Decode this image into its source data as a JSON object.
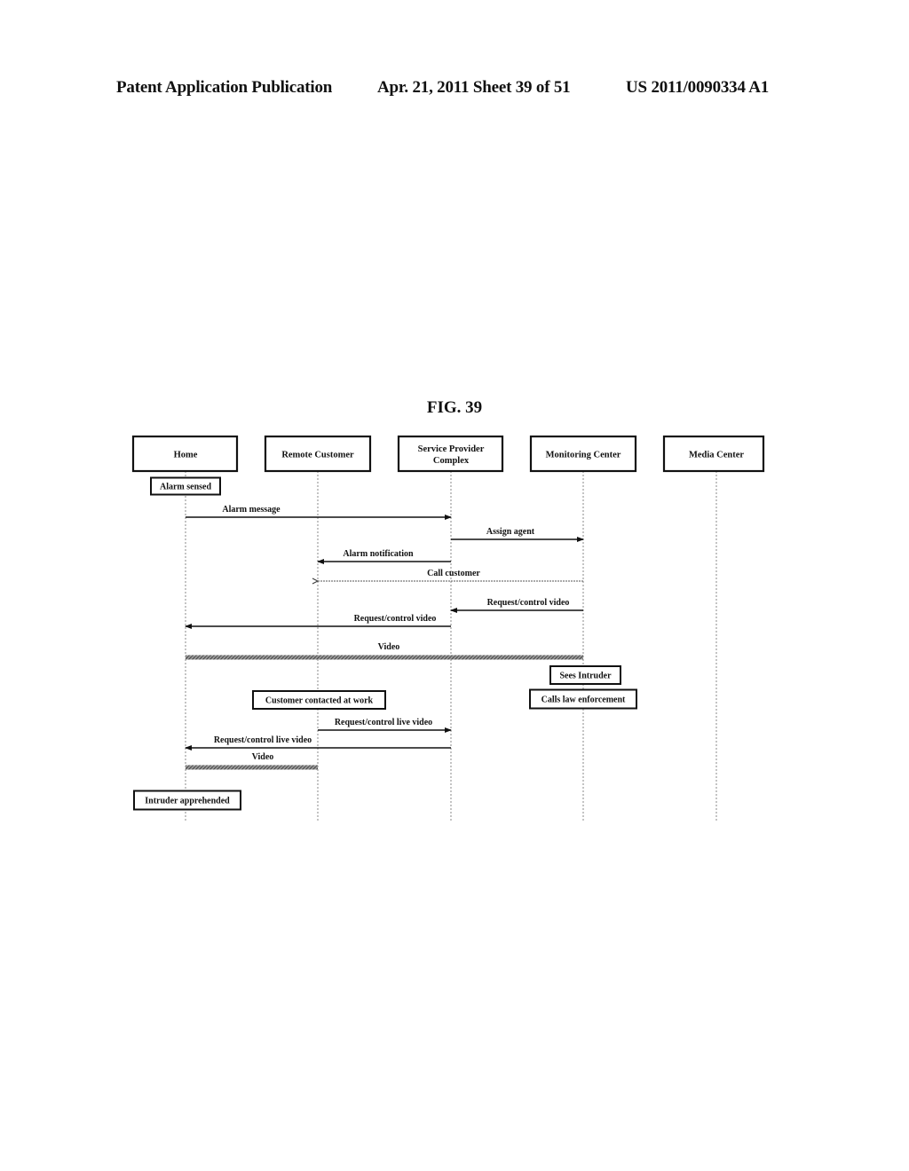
{
  "header": {
    "publication": "Patent Application Publication",
    "date_sheet": "Apr. 21, 2011  Sheet 39 of 51",
    "patent_number": "US 2011/0090334 A1"
  },
  "figure": {
    "title": "FIG. 39",
    "actors": [
      {
        "id": "home",
        "lines": [
          "Home"
        ]
      },
      {
        "id": "remote-customer",
        "lines": [
          "Remote Customer"
        ]
      },
      {
        "id": "service-provider-complex",
        "lines": [
          "Service Provider",
          "Complex"
        ]
      },
      {
        "id": "monitoring-center",
        "lines": [
          "Monitoring Center"
        ]
      },
      {
        "id": "media-center",
        "lines": [
          "Media Center"
        ]
      }
    ],
    "steps": [
      {
        "type": "note",
        "actor": 0,
        "label": "Alarm sensed"
      },
      {
        "type": "message",
        "from": 0,
        "to": 2,
        "label": "Alarm message",
        "style": "solid"
      },
      {
        "type": "message",
        "from": 2,
        "to": 3,
        "label": "Assign agent",
        "style": "solid"
      },
      {
        "type": "message",
        "from": 2,
        "to": 1,
        "label": "Alarm notification",
        "style": "solid"
      },
      {
        "type": "message",
        "from": 3,
        "to": 1,
        "label": "Call customer",
        "style": "dashed"
      },
      {
        "type": "message",
        "from": 3,
        "to": 2,
        "label": "Request/control video",
        "style": "solid"
      },
      {
        "type": "message",
        "from": 2,
        "to": 0,
        "label": "Request/control video",
        "style": "solid"
      },
      {
        "type": "stream",
        "from": 0,
        "to": 3,
        "label": "Video"
      },
      {
        "type": "note",
        "actor": 3,
        "label": "Sees Intruder"
      },
      {
        "type": "note",
        "actor": 1,
        "label": "Customer contacted at work"
      },
      {
        "type": "note",
        "actor": 3,
        "label": "Calls law enforcement"
      },
      {
        "type": "message",
        "from": 1,
        "to": 2,
        "label": "Request/control live video",
        "style": "solid"
      },
      {
        "type": "message",
        "from": 2,
        "to": 0,
        "label": "Request/control live video",
        "style": "solid"
      },
      {
        "type": "stream",
        "from": 0,
        "to": 1,
        "label": "Video"
      },
      {
        "type": "note",
        "actor": 0,
        "label": "Intruder apprehended"
      }
    ]
  }
}
